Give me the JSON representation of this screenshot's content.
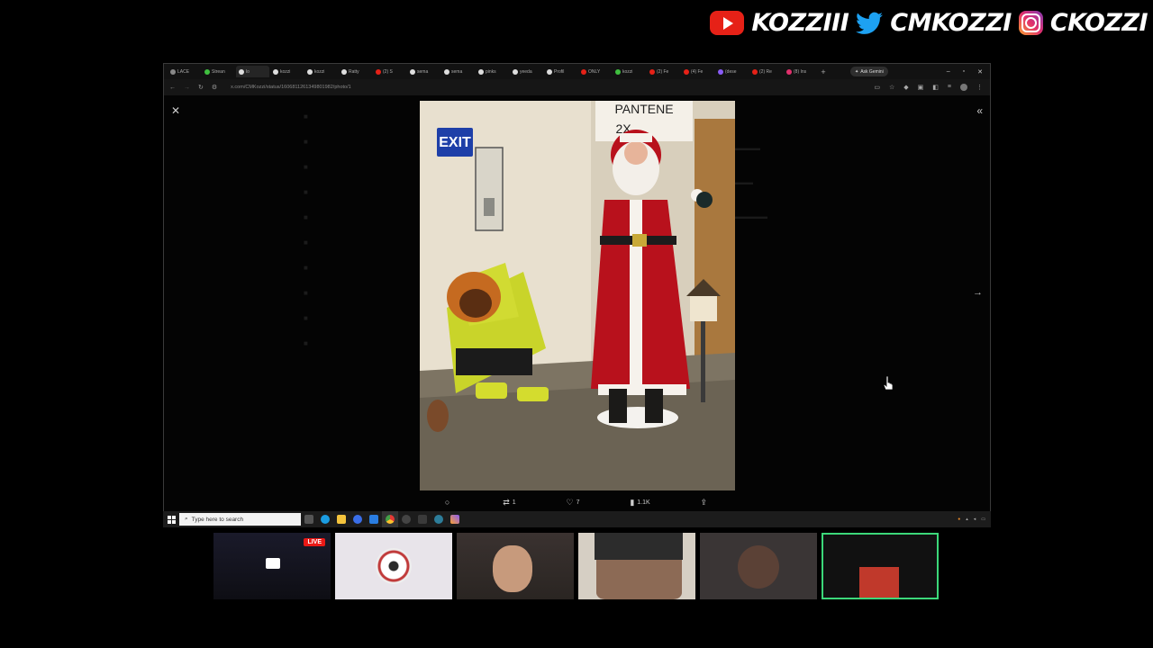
{
  "socials": [
    {
      "platform": "youtube",
      "icon": "youtube-icon",
      "handle": "KOZZIII",
      "color": "#e62117"
    },
    {
      "platform": "twitter",
      "icon": "twitter-icon",
      "handle": "CMKOZZI",
      "color": "#1da1f2"
    },
    {
      "platform": "instagram",
      "icon": "instagram-icon",
      "handle": "CKOZZI",
      "color": "#e1306c"
    }
  ],
  "browser": {
    "tabs": [
      {
        "label": "LACE",
        "color": "#888"
      },
      {
        "label": "Strean",
        "color": "#3fbf3f"
      },
      {
        "label": "lo",
        "color": "#ddd",
        "active": true
      },
      {
        "label": "kozzi",
        "color": "#ddd"
      },
      {
        "label": "kozzi",
        "color": "#ddd"
      },
      {
        "label": "Ratty",
        "color": "#ddd"
      },
      {
        "label": "(2) S",
        "color": "#e62117"
      },
      {
        "label": "sema",
        "color": "#ddd"
      },
      {
        "label": "sema",
        "color": "#ddd"
      },
      {
        "label": "pinks",
        "color": "#ddd"
      },
      {
        "label": "yeeda",
        "color": "#ddd"
      },
      {
        "label": "Profil",
        "color": "#ddd"
      },
      {
        "label": "ONLY",
        "color": "#e62117"
      },
      {
        "label": "kozzi",
        "color": "#3fbf3f"
      },
      {
        "label": "(2) Fe",
        "color": "#e62117"
      },
      {
        "label": "(4) Fe",
        "color": "#e62117"
      },
      {
        "label": "(dese",
        "color": "#8a5cf6"
      },
      {
        "label": "(2) Re",
        "color": "#e62117"
      },
      {
        "label": "(8) Ins",
        "color": "#e1306c"
      }
    ],
    "ask_gemini": "Ask Gemini",
    "url": "x.com/CMKozzi/status/1606811261349801982/photo/1"
  },
  "post": {
    "actions": [
      {
        "name": "reply",
        "icon": "reply-icon",
        "glyph": "○",
        "count": ""
      },
      {
        "name": "repost",
        "icon": "repost-icon",
        "glyph": "⇄",
        "count": "1"
      },
      {
        "name": "like",
        "icon": "heart-icon",
        "glyph": "♡",
        "count": "7"
      },
      {
        "name": "views",
        "icon": "views-icon",
        "glyph": "▮",
        "count": "1.1K"
      },
      {
        "name": "share",
        "icon": "share-icon",
        "glyph": "⇪",
        "count": ""
      }
    ]
  },
  "photo_text": {
    "sign": "EXIT",
    "banner": "PANTENE",
    "banner2": "2X"
  },
  "taskbar": {
    "search_placeholder": "Type here to search"
  },
  "stream": {
    "live_label": "LIVE"
  }
}
